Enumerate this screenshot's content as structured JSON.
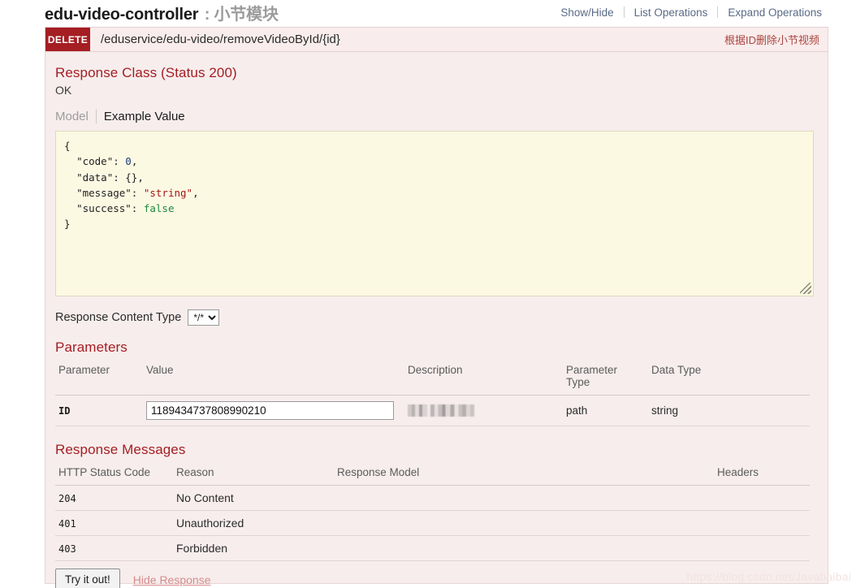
{
  "header": {
    "resource_name": "edu-video-controller",
    "separator": " : ",
    "resource_cn": "小节模块",
    "links": [
      {
        "label": "Show/Hide"
      },
      {
        "label": "List Operations"
      },
      {
        "label": "Expand Operations"
      }
    ]
  },
  "operation": {
    "method": "DELETE",
    "path": "/eduservice/edu-video/removeVideoById/{id}",
    "summary": "根据ID删除小节视频"
  },
  "response_class": {
    "heading": "Response Class (Status 200)",
    "status_text": "OK",
    "tabs": [
      {
        "label": "Model",
        "active": false
      },
      {
        "label": "Example Value",
        "active": true
      }
    ],
    "example_value": {
      "open_brace": "{",
      "close_brace": "}",
      "fields": [
        {
          "key": "\"code\"",
          "value": "0",
          "type": "number",
          "comma": ","
        },
        {
          "key": "\"data\"",
          "value": "{}",
          "type": "plain",
          "comma": ","
        },
        {
          "key": "\"message\"",
          "value": "\"string\"",
          "type": "string",
          "comma": ","
        },
        {
          "key": "\"success\"",
          "value": "false",
          "type": "boolean",
          "comma": ""
        }
      ]
    }
  },
  "content_type": {
    "label": "Response Content Type",
    "selected": "*/*",
    "options": [
      "*/*"
    ]
  },
  "parameters": {
    "heading": "Parameters",
    "columns": [
      "Parameter",
      "Value",
      "Description",
      "Parameter Type",
      "Data Type"
    ],
    "column_ptype_line1": "Parameter",
    "column_ptype_line2": "Type",
    "rows": [
      {
        "name": "ID",
        "value": "1189434737808990210",
        "description": "",
        "description_redacted": true,
        "param_type": "path",
        "data_type": "string"
      }
    ]
  },
  "response_messages": {
    "heading": "Response Messages",
    "columns": [
      "HTTP Status Code",
      "Reason",
      "Response Model",
      "Headers"
    ],
    "rows": [
      {
        "code": "204",
        "reason": "No Content",
        "model": "",
        "headers": ""
      },
      {
        "code": "401",
        "reason": "Unauthorized",
        "model": "",
        "headers": ""
      },
      {
        "code": "403",
        "reason": "Forbidden",
        "model": "",
        "headers": ""
      }
    ]
  },
  "footer": {
    "try_label": "Try it out!",
    "hide_label": "Hide Response"
  },
  "watermark": "https://blog.csdn.net/Javabaibai",
  "colors": {
    "method_delete": "#a41e22",
    "accent": "#a41e22",
    "block_bg": "#f7eded",
    "code_bg": "#fcf9e3",
    "link": "#5a6b86"
  }
}
